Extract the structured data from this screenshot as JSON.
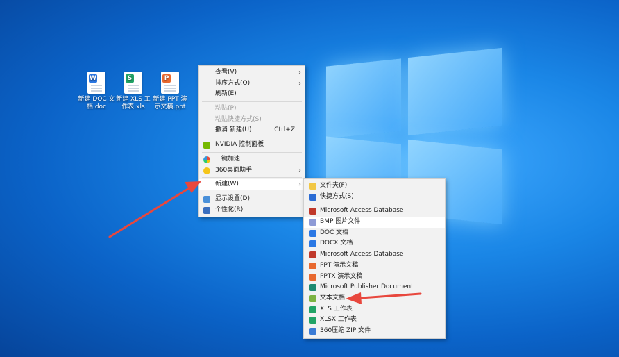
{
  "desktop": {
    "icons": [
      {
        "label": "新建 DOC 文档.doc",
        "color": "#2b78e4",
        "letter": "W"
      },
      {
        "label": "新建 XLS 工作表.xls",
        "color": "#21a366",
        "letter": "S"
      },
      {
        "label": "新建 PPT 演示文稿.ppt",
        "color": "#e8692f",
        "letter": "P"
      }
    ]
  },
  "context_menu": {
    "items": [
      {
        "label": "查看(V)",
        "submenu": true
      },
      {
        "label": "排序方式(O)",
        "submenu": true
      },
      {
        "label": "刷新(E)"
      },
      {
        "label": "粘贴(P)",
        "disabled": true
      },
      {
        "label": "粘贴快捷方式(S)",
        "disabled": true
      },
      {
        "label": "撤消 新建(U)",
        "shortcut": "Ctrl+Z"
      },
      {
        "label": "NVIDIA 控制面板",
        "icon": "nvidia-icon"
      },
      {
        "label": "一键加速",
        "icon": "speedup-icon"
      },
      {
        "label": "360桌面助手",
        "icon": "360-assistant-icon",
        "submenu": true
      },
      {
        "label": "新建(W)",
        "submenu": true,
        "highlight": true
      },
      {
        "label": "显示设置(D)",
        "icon": "display-settings-icon"
      },
      {
        "label": "个性化(R)",
        "icon": "personalize-icon"
      }
    ]
  },
  "new_submenu": {
    "items": [
      {
        "label": "文件夹(F)",
        "icon": "folder-icon",
        "color": "#f2c744"
      },
      {
        "label": "快捷方式(S)",
        "icon": "shortcut-icon",
        "color": "#2b6cd4"
      },
      {
        "label": "Microsoft Access Database",
        "icon": "access-icon",
        "color": "#c0392b"
      },
      {
        "label": "BMP 图片文件",
        "icon": "bmp-icon",
        "color": "#8e9bd6",
        "highlight": true
      },
      {
        "label": "DOC 文档",
        "icon": "doc-icon",
        "color": "#2b78e4"
      },
      {
        "label": "DOCX 文档",
        "icon": "docx-icon",
        "color": "#2b78e4"
      },
      {
        "label": "Microsoft Access Database",
        "icon": "access-icon",
        "color": "#c0392b"
      },
      {
        "label": "PPT 演示文稿",
        "icon": "ppt-icon",
        "color": "#e8692f"
      },
      {
        "label": "PPTX 演示文稿",
        "icon": "pptx-icon",
        "color": "#e8692f"
      },
      {
        "label": "Microsoft Publisher Document",
        "icon": "publisher-icon",
        "color": "#1f8a70"
      },
      {
        "label": "文本文档",
        "icon": "text-document-icon",
        "color": "#7cb342"
      },
      {
        "label": "XLS 工作表",
        "icon": "xls-icon",
        "color": "#21a366"
      },
      {
        "label": "XLSX 工作表",
        "icon": "xlsx-icon",
        "color": "#21a366"
      },
      {
        "label": "360压缩 ZIP 文件",
        "icon": "zip-icon",
        "color": "#3a7bd5"
      }
    ]
  },
  "annotations": {
    "arrow_color": "#e8473d"
  }
}
